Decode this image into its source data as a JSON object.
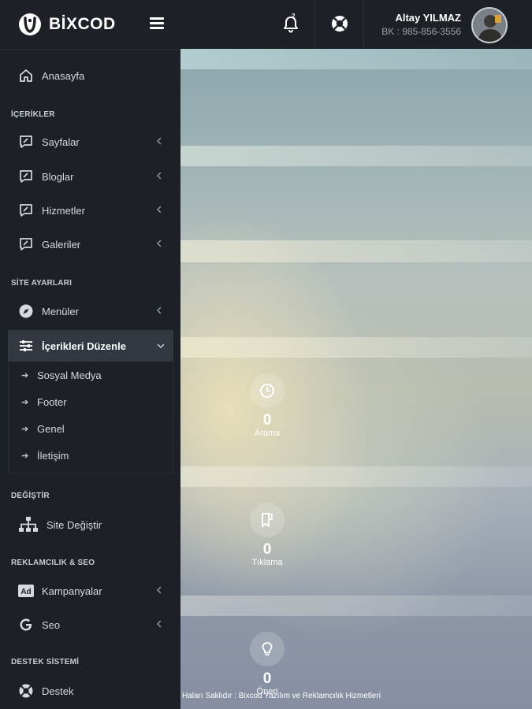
{
  "brand": {
    "name": "BİXCOD"
  },
  "header": {
    "notification_count": "2",
    "user_name": "Altay YILMAZ",
    "user_sub": "BK : 985-856-3556"
  },
  "sidebar": {
    "home": "Anasayfa",
    "sections": {
      "content": "İÇERİKLER",
      "site_settings": "SİTE AYARLARI",
      "change": "DEĞİŞTİR",
      "ads_seo": "REKLAMCILIK & SEO",
      "support": "DESTEK SİSTEMİ"
    },
    "items": {
      "pages": "Sayfalar",
      "blogs": "Bloglar",
      "services": "Hizmetler",
      "galleries": "Galeriler",
      "menus": "Menüler",
      "edit_contents": "İçerikleri Düzenle",
      "change_site": "Site Değiştir",
      "campaigns": "Kampanyalar",
      "seo": "Seo",
      "support": "Destek"
    },
    "submenu": [
      "Sosyal Medya",
      "Footer",
      "Genel",
      "İletişim"
    ],
    "ad_badge": "Ad"
  },
  "stats": [
    {
      "value": "0",
      "label": "Arama",
      "icon": "clock-icon"
    },
    {
      "value": "0",
      "label": "Tıklama",
      "icon": "bookmark-icon"
    },
    {
      "value": "0",
      "label": "Öneri",
      "icon": "lightbulb-icon"
    }
  ],
  "footer": {
    "text": "Haları Saklıdır : Bixcod Yazılım ve Reklamcılık Hizmetleri"
  },
  "colors": {
    "sidebar": "#1d2127",
    "active_item": "#333840",
    "text": "#d6dadf"
  }
}
